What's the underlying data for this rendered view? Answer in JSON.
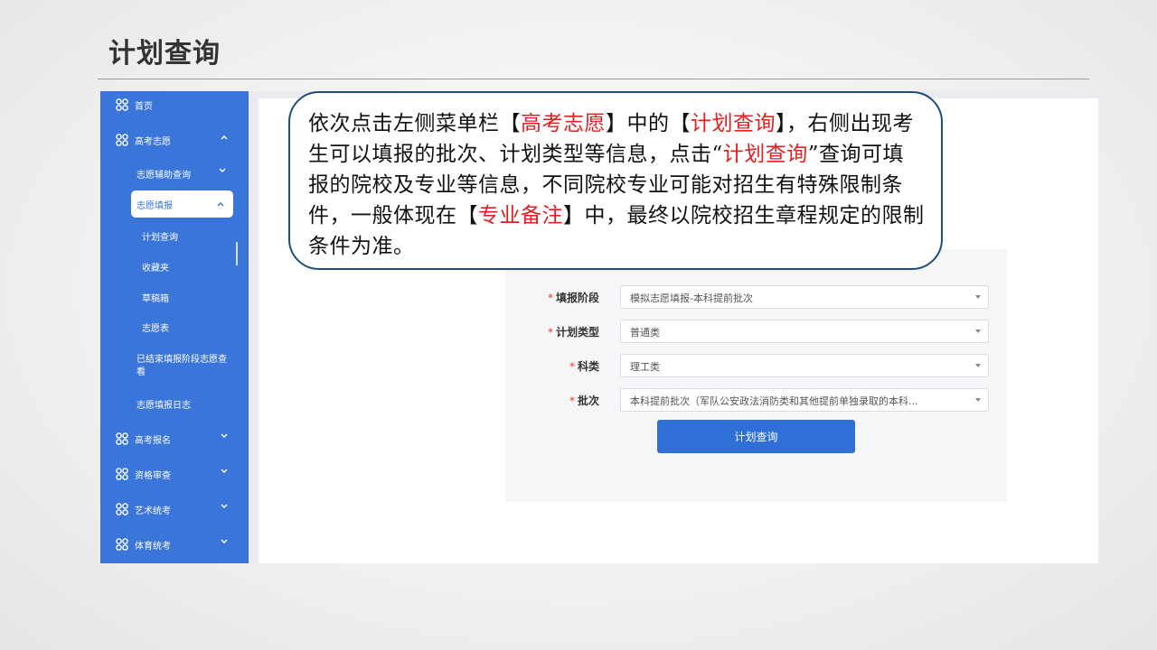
{
  "slide": {
    "title": "计划查询"
  },
  "sidebar": {
    "items": [
      {
        "label": "首页",
        "icon": "grid-icon"
      },
      {
        "label": "高考志愿",
        "icon": "grid-icon",
        "expanded": true
      },
      {
        "label": "志愿辅助查询"
      },
      {
        "label": "志愿填报",
        "selected": true
      },
      {
        "label": "计划查询"
      },
      {
        "label": "收藏夹"
      },
      {
        "label": "草稿箱"
      },
      {
        "label": "志愿表"
      },
      {
        "label": "已结束填报阶段志愿查看"
      },
      {
        "label": "志愿填报日志"
      },
      {
        "label": "高考报名",
        "icon": "grid-icon"
      },
      {
        "label": "资格审查",
        "icon": "grid-icon"
      },
      {
        "label": "艺术统考",
        "icon": "grid-icon"
      },
      {
        "label": "体育统考",
        "icon": "grid-icon"
      }
    ]
  },
  "form": {
    "fields": [
      {
        "label": "填报阶段",
        "value": "模拟志愿填报-本科提前批次"
      },
      {
        "label": "计划类型",
        "value": "普通类"
      },
      {
        "label": "科类",
        "value": "理工类"
      },
      {
        "label": "批次",
        "value": "本科提前批次（军队公安政法消防类和其他提前单独录取的本科..."
      }
    ],
    "required_mark": "*",
    "query_button": "计划查询"
  },
  "callout": {
    "p1": "依次点击左侧菜单栏【",
    "r1": "高考志愿",
    "p2": "】中的【",
    "r2": "计划查询",
    "p3": "】，右侧出现考生可以填报的批次、计划类型等信息，点击“",
    "r3": "计划查询",
    "p4": "”查询可填报的院校及专业等信息，不同院校专业可能对招生有特殊限制条件，一般体现在【",
    "r4": "专业备注",
    "p5": "】中，最终以院校招生章程规定的限制条件为准。"
  },
  "colors": {
    "sidebar": "#3a75d9",
    "accent_red": "#e02020",
    "callout_border": "#1f4e79",
    "button": "#2f6fd6"
  }
}
